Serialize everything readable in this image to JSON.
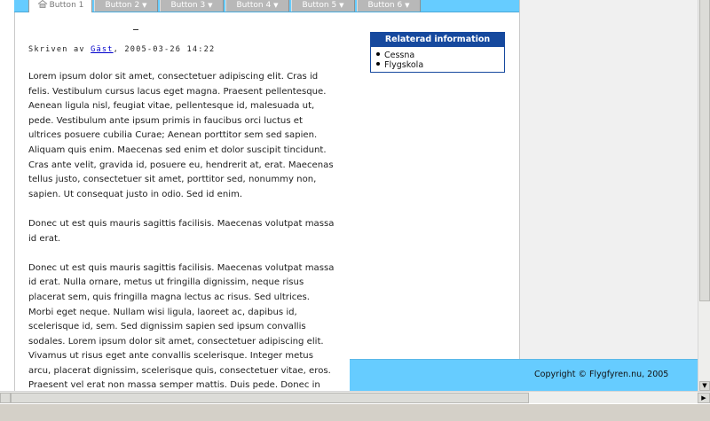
{
  "nav": {
    "tabs": [
      {
        "label": "Button 1",
        "icon": "home-icon",
        "active": true
      },
      {
        "label": "Button 2",
        "caret": "▼"
      },
      {
        "label": "Button 3",
        "caret": "▼"
      },
      {
        "label": "Button 4",
        "caret": "▼"
      },
      {
        "label": "Button 5",
        "caret": "▼"
      },
      {
        "label": "Button 6",
        "caret": "▼"
      }
    ]
  },
  "article": {
    "byline_prefix": "Skriven av ",
    "author": "Gäst",
    "byline_suffix": ", 2005-03-26 14:22",
    "paragraphs": [
      "Lorem ipsum dolor sit amet, consectetuer adipiscing elit. Cras id felis. Vestibulum cursus lacus eget magna. Praesent pellentesque. Aenean ligula nisl, feugiat vitae, pellentesque id, malesuada ut, pede. Vestibulum ante ipsum primis in faucibus orci luctus et ultrices posuere cubilia Curae; Aenean porttitor sem sed sapien. Aliquam quis enim. Maecenas sed enim et dolor suscipit tincidunt. Cras ante velit, gravida id, posuere eu, hendrerit at, erat. Maecenas tellus justo, consectetuer sit amet, porttitor sed, nonummy non, sapien. Ut consequat justo in odio. Sed id enim.",
      "Donec ut est quis mauris sagittis facilisis. Maecenas volutpat massa id erat.",
      "Donec ut est quis mauris sagittis facilisis. Maecenas volutpat massa id erat. Nulla ornare, metus ut fringilla dignissim, neque risus placerat sem, quis fringilla magna lectus ac risus. Sed ultrices. Morbi eget neque. Nullam wisi ligula, laoreet ac, dapibus id, scelerisque id, sem. Sed dignissim sapien sed ipsum convallis sodales. Lorem ipsum dolor sit amet, consectetuer adipiscing elit. Vivamus ut risus eget ante convallis scelerisque. Integer metus arcu, placerat dignissim, scelerisque quis, consectetuer vitae, eros. Praesent vel erat non massa semper mattis. Duis pede. Donec in eros sit amet lectus"
    ]
  },
  "related": {
    "title": "Relaterad information",
    "items": [
      "Cessna",
      "Flygskola"
    ]
  },
  "footer": {
    "copyright": "Copyright © Flygfyren.nu, 2005"
  },
  "scrollbar": {
    "down_arrow": "▼",
    "right_arrow": "▶"
  },
  "colors": {
    "nav_bar": "#66ccff",
    "related_header": "#16499e",
    "footer": "#66ccff",
    "link": "#0000cc"
  }
}
